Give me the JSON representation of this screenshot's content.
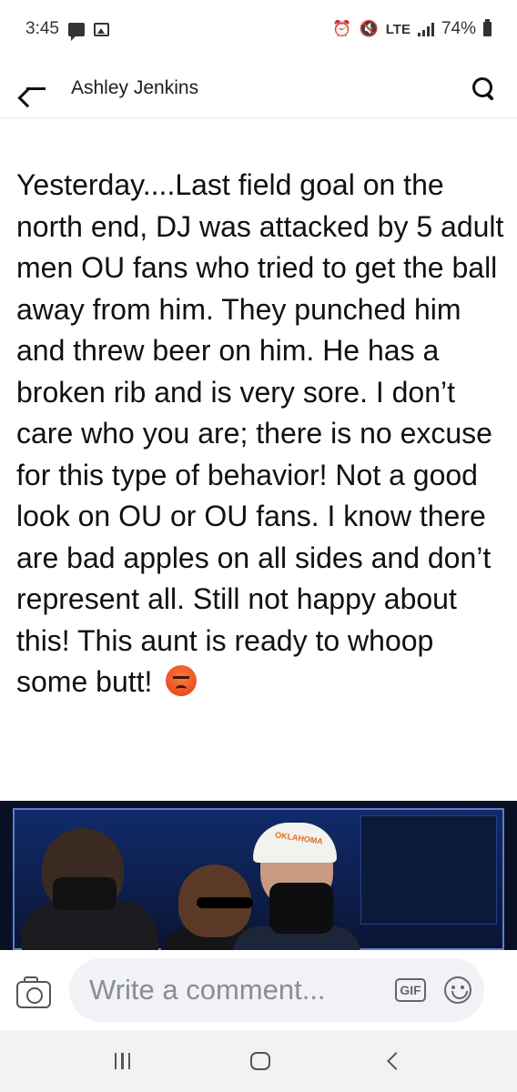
{
  "status_bar": {
    "time": "3:45",
    "network": "LTE",
    "battery": "74%",
    "icons": [
      "message-icon",
      "image-icon",
      "alarm-icon",
      "mute-icon",
      "volte-icon",
      "signal-icon",
      "battery-icon"
    ]
  },
  "header": {
    "title": "Ashley Jenkins",
    "back_icon": "back-arrow-icon",
    "search_icon": "search-icon"
  },
  "post": {
    "text": "Yesterday....Last field goal on the north end, DJ was attacked by 5 adult men OU fans who tried to get the ball away from him. They punched him and threw beer on him. He has a broken rib and is very sore. I don’t care who you are; there is no excuse for this type of behavior! Not a good look on OU or OU fans. I know there are bad apples on all sides and don’t represent all. Still not happy about this! This aunt is ready to whoop some butt!",
    "emoji": "angry-face-emoji",
    "cap_text": "OKLAHOMA"
  },
  "comment_bar": {
    "placeholder": "Write a comment...",
    "gif_label": "GIF"
  },
  "colors": {
    "header_border": "#e4e6eb",
    "input_bg": "#f0f2f5",
    "placeholder": "#8a8d91"
  }
}
